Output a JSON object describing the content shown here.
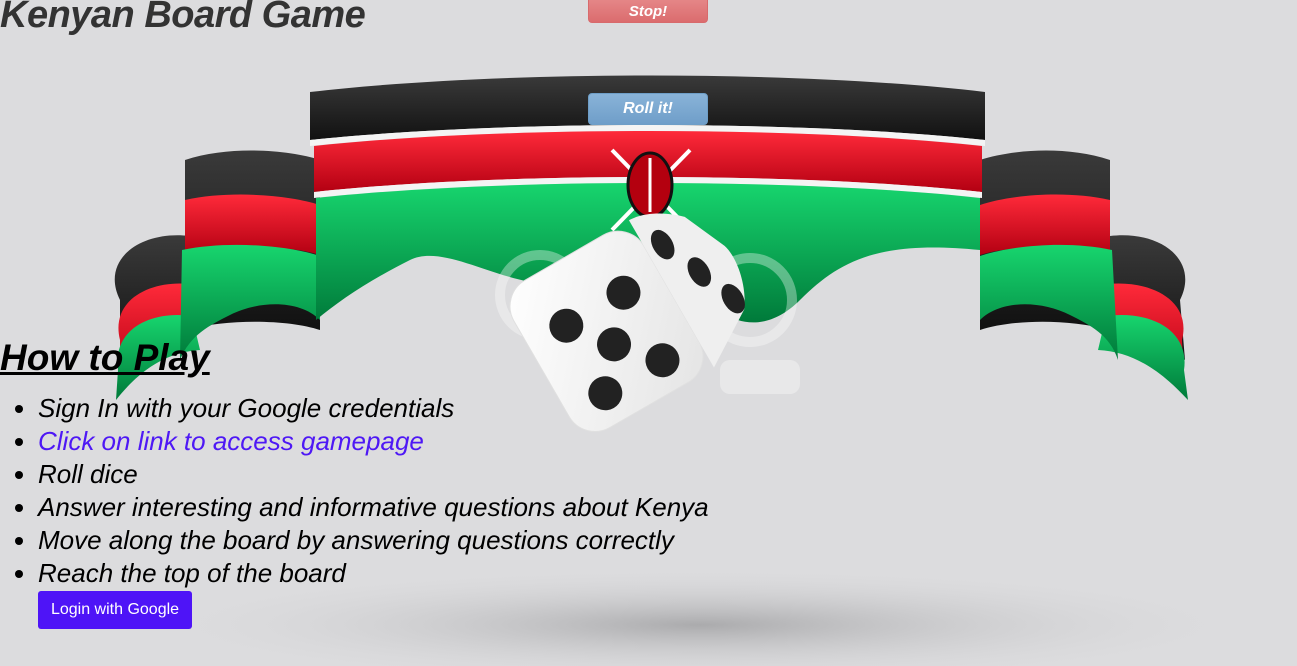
{
  "header": {
    "title": "Kenyan Board Game"
  },
  "controls": {
    "stop_label": "Stop!",
    "roll_label": "Roll it!"
  },
  "instructions": {
    "heading": "How to Play",
    "steps": [
      "Sign In with your Google credentials",
      "Click on link to access gamepage",
      "Roll dice",
      "Answer interesting and informative questions about Kenya",
      "Move along the board by answering questions correctly",
      "Reach the top of the board"
    ]
  },
  "auth": {
    "login_label": "Login with Google"
  },
  "colors": {
    "background": "#dcdcde",
    "link": "#4e18f5",
    "login_button": "#4e14f7",
    "stop_button": "#e07a7c",
    "roll_button": "#7aa7d1",
    "flag_black": "#1b1b1b",
    "flag_red": "#d0021b",
    "flag_green": "#00a650"
  }
}
